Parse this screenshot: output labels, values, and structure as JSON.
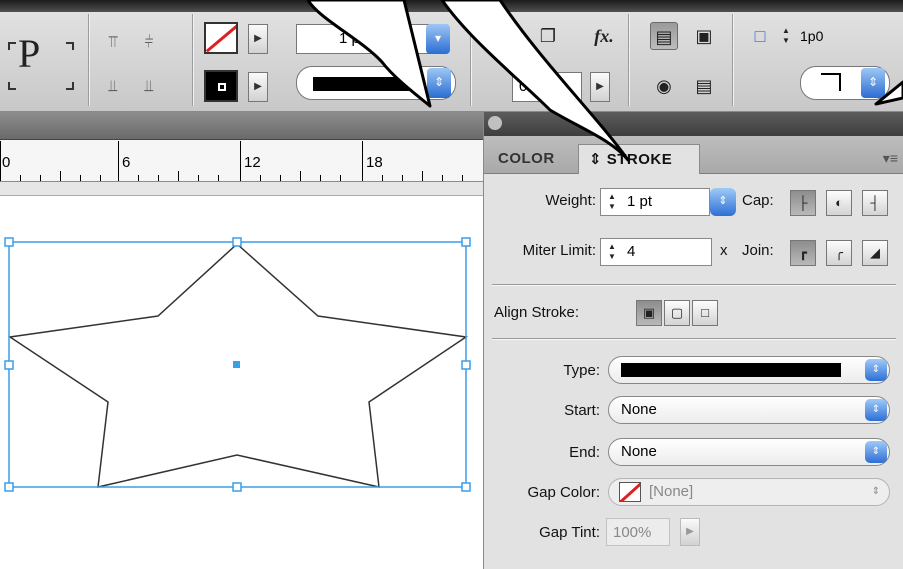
{
  "toolbar": {
    "stroke_weight_value": "1 pt",
    "opacity_value": "00%",
    "fx_label": "fx.",
    "corner_size_value": "1p0",
    "type_char": "P"
  },
  "ruler": {
    "labels": [
      "0",
      "6",
      "12",
      "18"
    ]
  },
  "panel": {
    "tab_color": "COLOR",
    "tab_stroke": "⇕ STROKE",
    "menu_icon": "▾≡",
    "weight_label": "Weight:",
    "weight_value": "1 pt",
    "cap_label": "Cap:",
    "miter_label": "Miter Limit:",
    "miter_value": "4",
    "miter_suffix": "x",
    "join_label": "Join:",
    "align_label": "Align Stroke:",
    "type_label": "Type:",
    "start_label": "Start:",
    "start_value": "None",
    "end_label": "End:",
    "end_value": "None",
    "gap_color_label": "Gap Color:",
    "gap_color_value": "[None]",
    "gap_tint_label": "Gap Tint:",
    "gap_tint_value": "100%"
  },
  "colors": {
    "selection_blue": "#3a9ee8",
    "accent_blue": "#2d6fd6",
    "none_red": "#e02020"
  },
  "icons": [
    "stepper-icon",
    "dropdown-caret-icon",
    "cap-butt-icon",
    "cap-round-icon",
    "cap-projecting-icon",
    "join-miter-icon",
    "join-round-icon",
    "join-bevel-icon",
    "align-center-icon",
    "align-inside-icon",
    "align-outside-icon",
    "none-swatch-icon",
    "panel-menu-icon",
    "fx-icon"
  ]
}
